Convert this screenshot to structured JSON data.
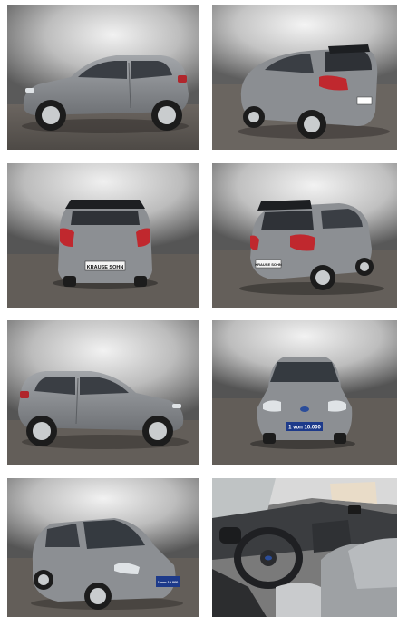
{
  "gallery": {
    "photos": [
      {
        "view": "side-left",
        "dealer_plate": ""
      },
      {
        "view": "rear-three-quarter-right",
        "dealer_plate": ""
      },
      {
        "view": "rear",
        "dealer_plate": "KRAUSE SOHN"
      },
      {
        "view": "rear-three-quarter-left",
        "dealer_plate": "KRAUSE SOHN"
      },
      {
        "view": "side-right",
        "dealer_plate": ""
      },
      {
        "view": "front",
        "dealer_plate": "1 von 10.000"
      },
      {
        "view": "front-three-quarter",
        "dealer_plate": "1 von 10.000"
      },
      {
        "view": "interior",
        "dealer_plate": ""
      }
    ]
  },
  "colors": {
    "car_body": "#8a8d91",
    "floor": "#5c5753",
    "wall_light": "#e6e6e6",
    "wall_dark": "#4a4a4a",
    "taillight": "#c0282e",
    "plate_blue": "#1d3a8a"
  },
  "icons": [
    "car-photo",
    "interior-photo"
  ]
}
